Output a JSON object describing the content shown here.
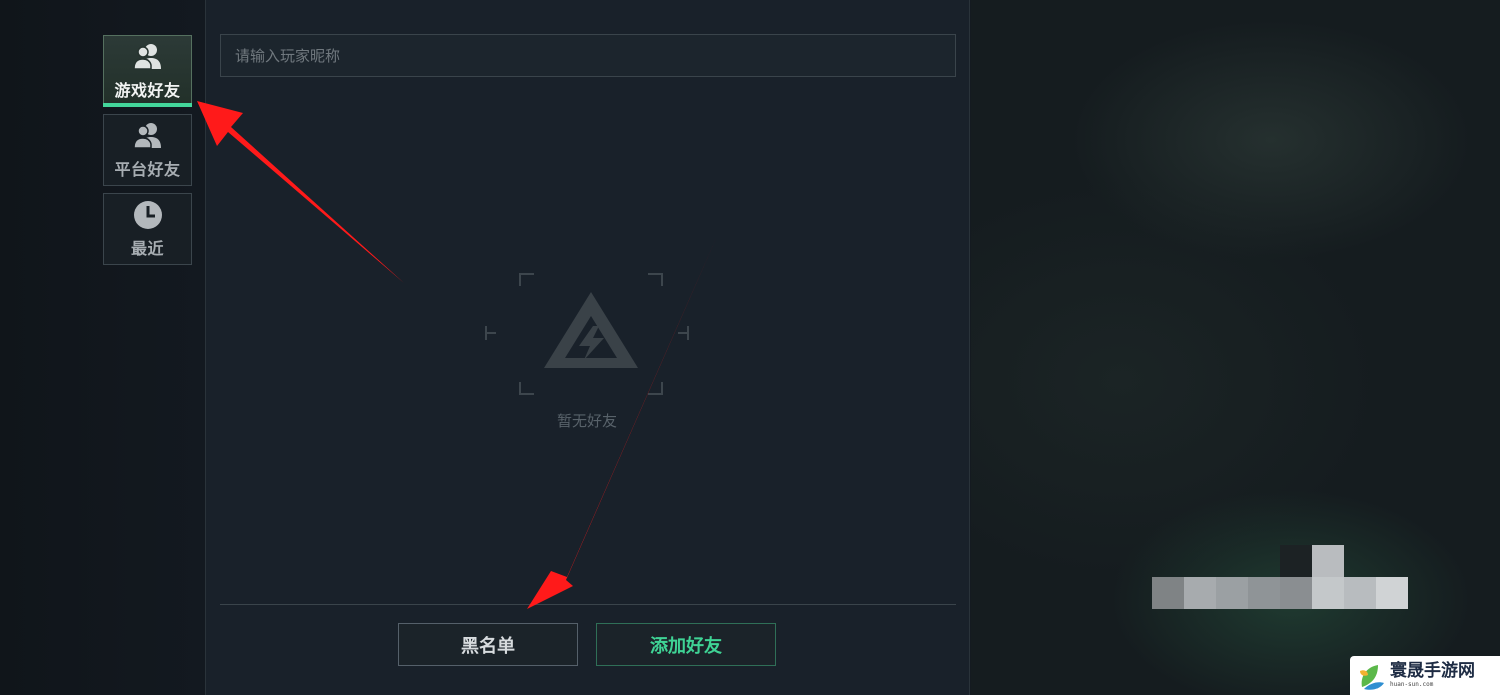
{
  "sidebar": {
    "tabs": [
      {
        "id": "game-friends",
        "label": "游戏好友",
        "icon": "users-icon",
        "active": true
      },
      {
        "id": "platform-friends",
        "label": "平台好友",
        "icon": "users-icon",
        "active": false
      },
      {
        "id": "recent",
        "label": "最近",
        "icon": "clock-icon",
        "active": false
      }
    ]
  },
  "search": {
    "placeholder": "请输入玩家昵称",
    "value": ""
  },
  "empty_state": {
    "text": "暂无好友",
    "icon": "warning-triangle-icon"
  },
  "footer": {
    "blacklist_label": "黑名单",
    "add_friend_label": "添加好友"
  },
  "watermark": {
    "title": "寰晟手游网",
    "subtitle": "huan-sun.com"
  },
  "colors": {
    "accent": "#43d79b",
    "annotation_arrow": "#ff1a1a",
    "panel_bg": "#19212a"
  }
}
